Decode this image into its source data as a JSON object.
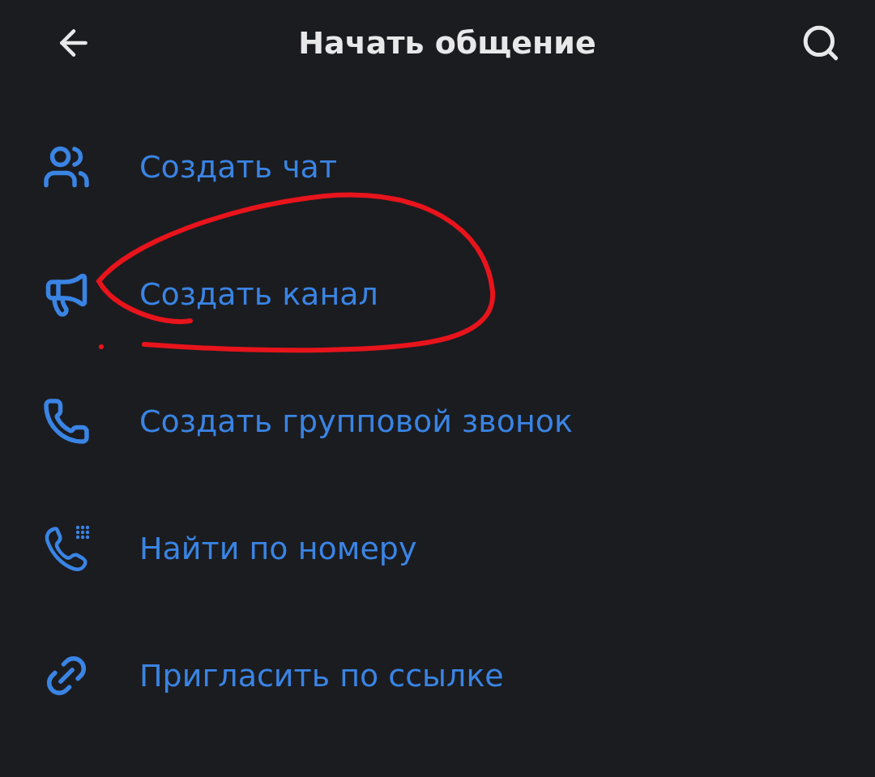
{
  "header": {
    "title": "Начать общение"
  },
  "items": [
    {
      "kind": "group-chat",
      "label": "Создать чат"
    },
    {
      "kind": "channel",
      "label": "Создать канал"
    },
    {
      "kind": "call",
      "label": "Создать групповой звонок"
    },
    {
      "kind": "dial",
      "label": "Найти по номеру"
    },
    {
      "kind": "link",
      "label": "Пригласить по ссылке"
    }
  ]
}
